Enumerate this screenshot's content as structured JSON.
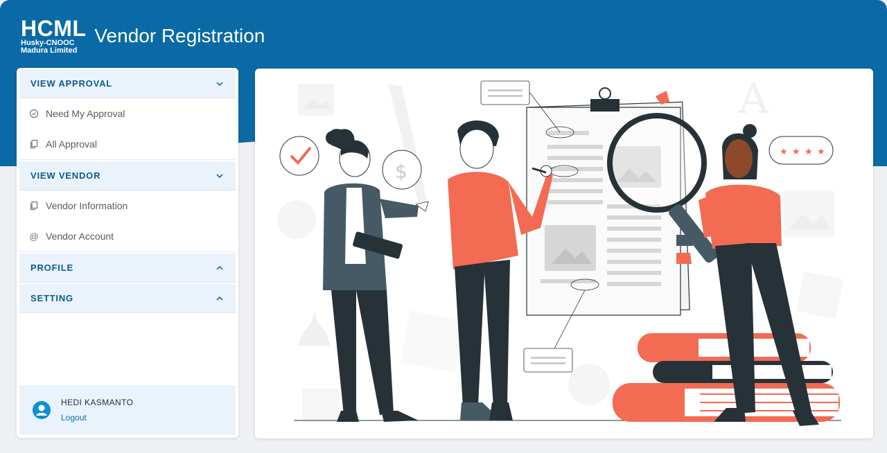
{
  "header": {
    "logo_main": "HCML",
    "logo_sub_1": "Husky-CNOOC",
    "logo_sub_2": "Madura Limited",
    "title": "Vendor Registration"
  },
  "sidebar": {
    "sections": [
      {
        "label": "VIEW APPROVAL",
        "chevron": "chevron-down-icon",
        "items": [
          {
            "label": "Need My Approval",
            "icon": "check-circle-icon"
          },
          {
            "label": "All Approval",
            "icon": "documents-icon"
          }
        ]
      },
      {
        "label": "VIEW VENDOR",
        "chevron": "chevron-down-icon",
        "items": [
          {
            "label": "Vendor Information",
            "icon": "documents-icon"
          },
          {
            "label": "Vendor Account",
            "icon": "at-icon"
          }
        ]
      },
      {
        "label": "PROFILE",
        "chevron": "chevron-up-icon"
      },
      {
        "label": "SETTING",
        "chevron": "chevron-up-icon"
      }
    ],
    "user": {
      "name": "HEDI KASMANTO",
      "logout": "Logout"
    }
  },
  "colors": {
    "brand_blue": "#0a6aa6",
    "accent_coral": "#f26b52",
    "dark_navy": "#263238"
  }
}
